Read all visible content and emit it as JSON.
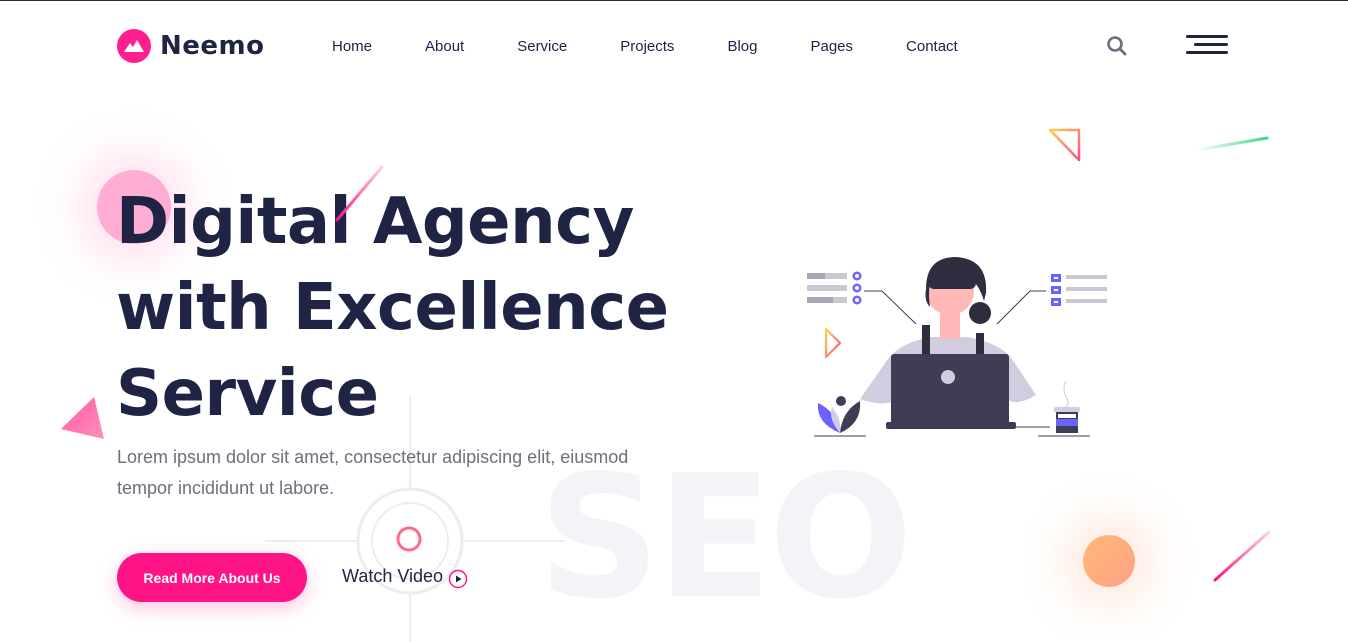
{
  "brand": {
    "name": "Neemo",
    "logo_icon": "mountain-logo-icon",
    "accent": "#ff1486",
    "dark": "#1f2344"
  },
  "nav": {
    "items": [
      {
        "label": "Home"
      },
      {
        "label": "About"
      },
      {
        "label": "Service"
      },
      {
        "label": "Projects"
      },
      {
        "label": "Blog"
      },
      {
        "label": "Pages"
      },
      {
        "label": "Contact"
      }
    ],
    "search_icon": "search-icon",
    "menu_icon": "hamburger-menu-icon"
  },
  "hero": {
    "title_line1": "Digital Agency",
    "title_line2": "with Excellence",
    "title_line3": "Service",
    "description": "Lorem ipsum dolor sit amet, consectetur adipiscing elit, eiusmod tempor incididunt ut labore.",
    "cta_label": "Read More About Us",
    "video_label": "Watch Video",
    "video_icon": "play-circle-icon"
  },
  "decor": {
    "watermark": "SEO",
    "illustration": "person-with-laptop-illustration"
  }
}
